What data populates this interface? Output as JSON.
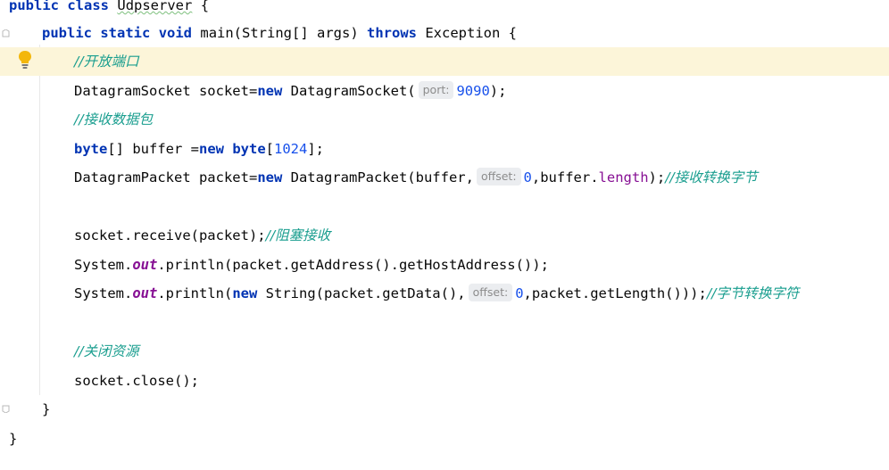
{
  "code": {
    "line1": {
      "kw1": "public",
      "kw2": "class",
      "name": "Udpserver",
      "brace": " {"
    },
    "line2": {
      "kw1": "public",
      "kw2": "static",
      "kw3": "void",
      "sig": "main(String[] args) ",
      "kw4": "throws",
      "rest": " Exception {"
    },
    "line3": {
      "comment": "//开放端口"
    },
    "line4": {
      "pre": "DatagramSocket socket=",
      "kw": "new",
      "mid": " DatagramSocket(",
      "hint": "port:",
      "num": "9090",
      "end": ");"
    },
    "line5": {
      "comment": "//接收数据包"
    },
    "line6": {
      "kw1": "byte",
      "mid": "[] buffer =",
      "kw2": "new",
      "sp": " ",
      "kw3": "byte",
      "open": "[",
      "num": "1024",
      "end": "];"
    },
    "line7": {
      "pre": "DatagramPacket packet=",
      "kw": "new",
      "mid": " DatagramPacket(buffer,",
      "hint": "offset:",
      "num": "0",
      "mid2": ",buffer.",
      "field": "length",
      "end": ");",
      "comment": "//接收转换字节"
    },
    "line8": {
      "pre": "socket.receive(packet);",
      "comment": "//阻塞接收"
    },
    "line9": {
      "pre": "System.",
      "field": "out",
      "rest": ".println(packet.getAddress().getHostAddress());"
    },
    "line10": {
      "pre": "System.",
      "field": "out",
      "mid": ".println(",
      "kw": "new",
      "mid2": " String(packet.getData(),",
      "hint": "offset:",
      "num": "0",
      "end": ",packet.getLength()));",
      "comment": "//字节转换字符"
    },
    "line11": {
      "comment": "//关闭资源"
    },
    "line12": {
      "text": "socket.close();"
    },
    "line13": {
      "text": "}"
    },
    "line14": {
      "text": "}"
    }
  },
  "icons": {
    "intention_bulb": "lightbulb-icon",
    "fold_markers": "fold-marker-icon"
  },
  "colors": {
    "keyword": "#0033b3",
    "number": "#1750eb",
    "comment": "#1a9e8f",
    "field": "#871094",
    "current_line": "#fcf5d9"
  }
}
